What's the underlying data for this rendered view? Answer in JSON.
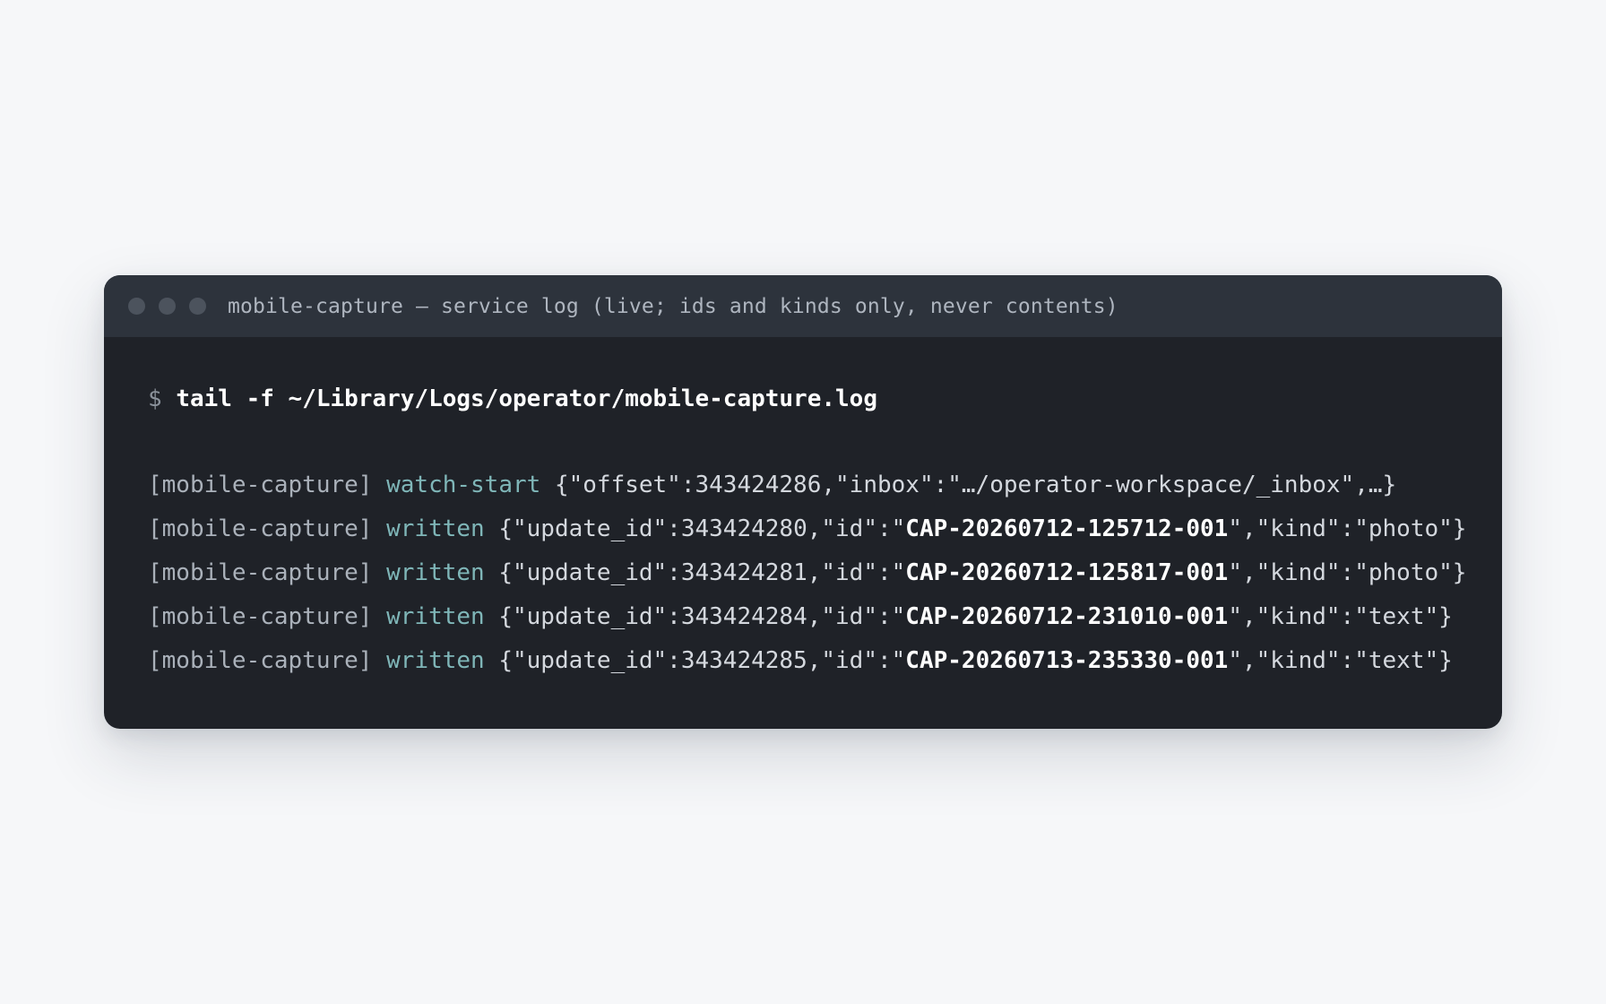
{
  "window": {
    "title": "mobile-capture — service log (live; ids and kinds only, never contents)",
    "controls": [
      "close-dot",
      "minimize-dot",
      "maximize-dot"
    ]
  },
  "terminal": {
    "prompt": "$",
    "command": "tail -f ~/Library/Logs/operator/mobile-capture.log",
    "lines": [
      {
        "tag": "[mobile-capture]",
        "event": "watch-start",
        "pre": "{\"offset\":343424286,\"inbox\":\"…/operator-workspace/_inbox\",…}",
        "id": "",
        "post": ""
      },
      {
        "tag": "[mobile-capture]",
        "event": "written",
        "pre": "{\"update_id\":343424280,\"id\":\"",
        "id": "CAP-20260712-125712-001",
        "post": "\",\"kind\":\"photo\"}"
      },
      {
        "tag": "[mobile-capture]",
        "event": "written",
        "pre": "{\"update_id\":343424281,\"id\":\"",
        "id": "CAP-20260712-125817-001",
        "post": "\",\"kind\":\"photo\"}"
      },
      {
        "tag": "[mobile-capture]",
        "event": "written",
        "pre": "{\"update_id\":343424284,\"id\":\"",
        "id": "CAP-20260712-231010-001",
        "post": "\",\"kind\":\"text\"}"
      },
      {
        "tag": "[mobile-capture]",
        "event": "written",
        "pre": "{\"update_id\":343424285,\"id\":\"",
        "id": "CAP-20260713-235330-001",
        "post": "\",\"kind\":\"text\"}"
      }
    ]
  },
  "colors": {
    "page_background": "#f6f7f9",
    "terminal_background": "#1f2228",
    "titlebar_background": "#2d333c",
    "event_accent": "#7fb6b8",
    "command_text": "#ffffff"
  }
}
